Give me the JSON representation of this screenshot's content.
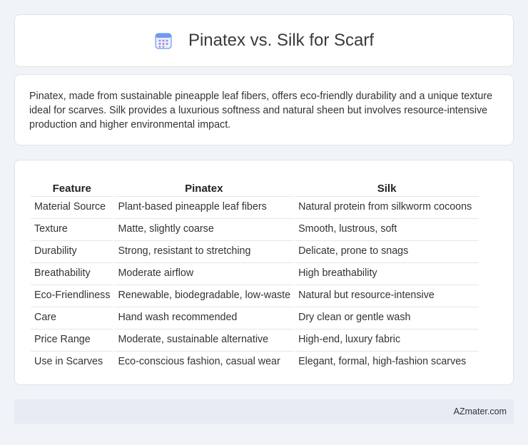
{
  "header": {
    "title": "Pinatex vs. Silk for Scarf",
    "icon": "calendar-icon",
    "icon_color": "#5b8def"
  },
  "intro": {
    "text": "Pinatex, made from sustainable pineapple leaf fibers, offers eco-friendly durability and a unique texture ideal for scarves. Silk provides a luxurious softness and natural sheen but involves resource-intensive production and higher environmental impact."
  },
  "table": {
    "headers": [
      "Feature",
      "Pinatex",
      "Silk"
    ],
    "rows": [
      [
        "Material Source",
        "Plant-based pineapple leaf fibers",
        "Natural protein from silkworm cocoons"
      ],
      [
        "Texture",
        "Matte, slightly coarse",
        "Smooth, lustrous, soft"
      ],
      [
        "Durability",
        "Strong, resistant to stretching",
        "Delicate, prone to snags"
      ],
      [
        "Breathability",
        "Moderate airflow",
        "High breathability"
      ],
      [
        "Eco-Friendliness",
        "Renewable, biodegradable, low-waste",
        "Natural but resource-intensive"
      ],
      [
        "Care",
        "Hand wash recommended",
        "Dry clean or gentle wash"
      ],
      [
        "Price Range",
        "Moderate, sustainable alternative",
        "High-end, luxury fabric"
      ],
      [
        "Use in Scarves",
        "Eco-conscious fashion, casual wear",
        "Elegant, formal, high-fashion scarves"
      ]
    ]
  },
  "footer": {
    "site": "AZmater.com"
  }
}
